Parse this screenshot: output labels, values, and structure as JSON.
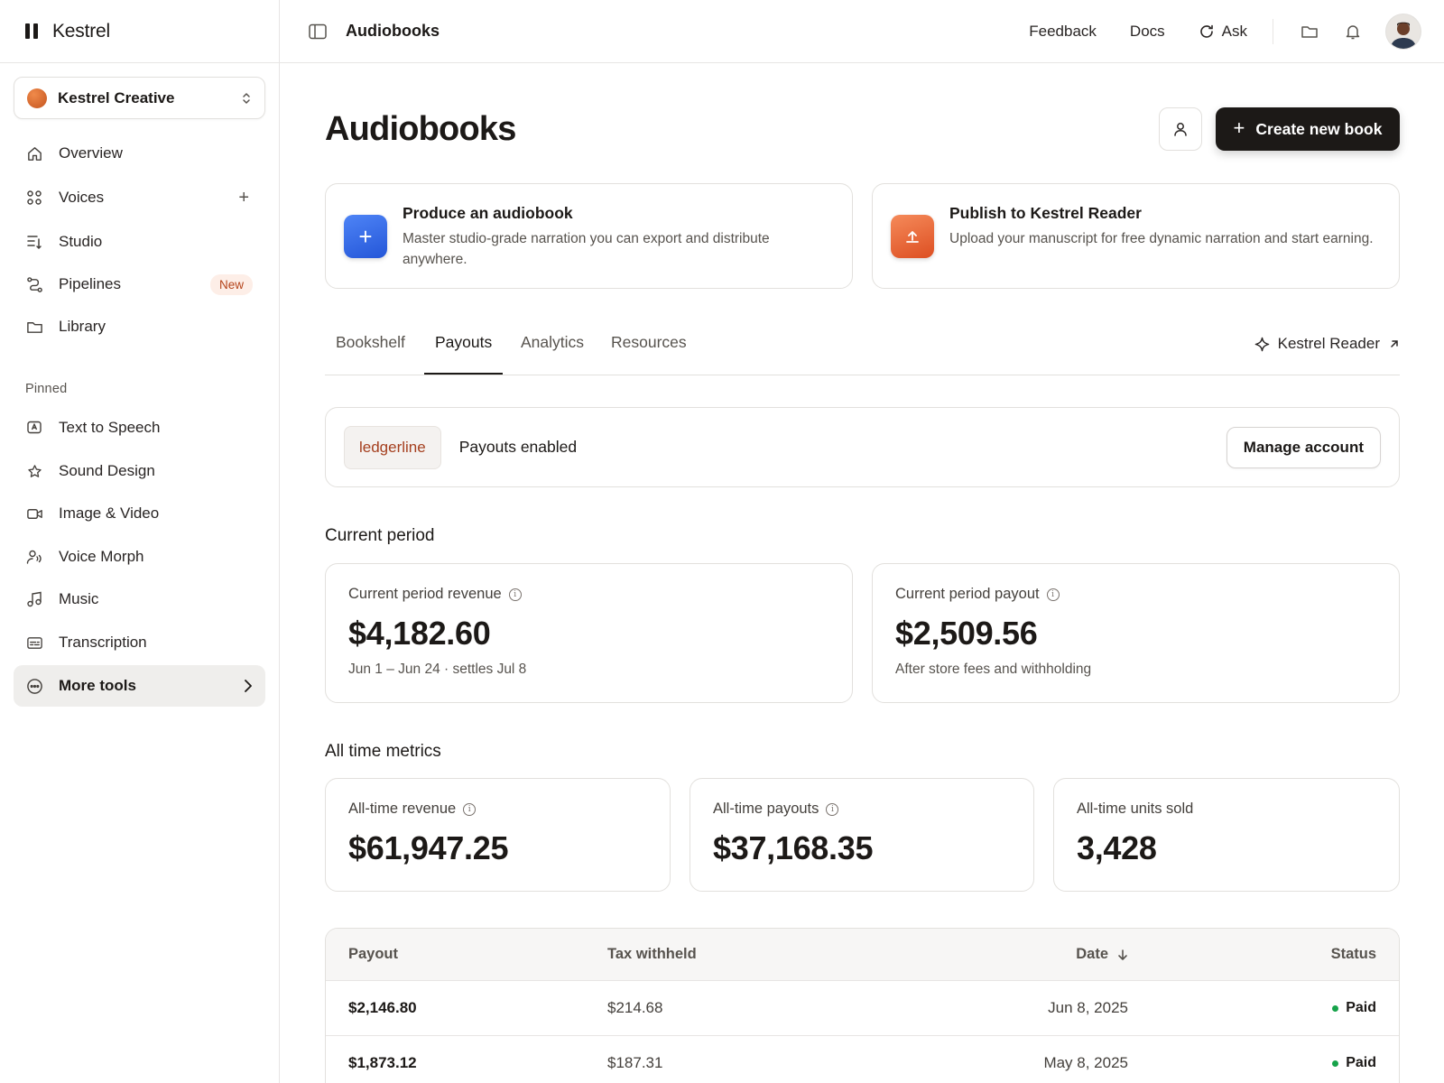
{
  "brand": {
    "name": "Kestrel"
  },
  "workspace": {
    "name": "Kestrel Creative"
  },
  "nav": [
    {
      "label": "Overview",
      "icon": "home-icon"
    },
    {
      "label": "Voices",
      "icon": "grid-dots-icon",
      "action": "+"
    },
    {
      "label": "Studio",
      "icon": "studio-icon"
    },
    {
      "label": "Pipelines",
      "icon": "pipeline-icon",
      "badge": "New"
    },
    {
      "label": "Library",
      "icon": "folder-icon"
    }
  ],
  "pinned": {
    "label": "Pinned",
    "items": [
      {
        "label": "Text to Speech",
        "icon": "tts-icon"
      },
      {
        "label": "Sound Design",
        "icon": "star-icon"
      },
      {
        "label": "Image & Video",
        "icon": "video-icon"
      },
      {
        "label": "Voice Morph",
        "icon": "voice-morph-icon"
      },
      {
        "label": "Music",
        "icon": "music-icon"
      },
      {
        "label": "Transcription",
        "icon": "transcription-icon"
      }
    ]
  },
  "more_tools": {
    "label": "More tools"
  },
  "topbar": {
    "title": "Audiobooks",
    "links": {
      "feedback": "Feedback",
      "docs": "Docs",
      "ask": "Ask"
    }
  },
  "page": {
    "title": "Audiobooks",
    "create_label": "Create new book"
  },
  "promos": [
    {
      "title": "Produce an audiobook",
      "desc": "Master studio-grade narration you can export and distribute anywhere.",
      "icon": "plus-icon"
    },
    {
      "title": "Publish to Kestrel Reader",
      "desc": "Upload your manuscript for free dynamic narration and start earning.",
      "icon": "upload-icon"
    }
  ],
  "tabs": [
    "Bookshelf",
    "Payouts",
    "Analytics",
    "Resources"
  ],
  "active_tab": "Payouts",
  "external_link": "Kestrel Reader",
  "payouts": {
    "provider": "ledgerline",
    "status": "Payouts enabled",
    "manage_label": "Manage account"
  },
  "current_period": {
    "heading": "Current period",
    "revenue": {
      "label": "Current period revenue",
      "value": "$4,182.60",
      "sub": "Jun 1 – Jun 24 · settles Jul 8"
    },
    "payout": {
      "label": "Current period payout",
      "value": "$2,509.56",
      "sub": "After store fees and withholding"
    }
  },
  "all_time": {
    "heading": "All time metrics",
    "revenue": {
      "label": "All-time revenue",
      "value": "$61,947.25"
    },
    "payouts": {
      "label": "All-time payouts",
      "value": "$37,168.35"
    },
    "units": {
      "label": "All-time units sold",
      "value": "3,428"
    }
  },
  "table": {
    "headers": {
      "payout": "Payout",
      "tax": "Tax withheld",
      "date": "Date",
      "status": "Status"
    },
    "rows": [
      {
        "payout": "$2,146.80",
        "tax": "$214.68",
        "date": "Jun 8, 2025",
        "status": "Paid"
      },
      {
        "payout": "$1,873.12",
        "tax": "$187.31",
        "date": "May 8, 2025",
        "status": "Paid"
      }
    ]
  },
  "colors": {
    "accent": "#1c1917",
    "badge_text": "#b4441b",
    "paid": "#16a34a",
    "provider": "#a5401f"
  }
}
